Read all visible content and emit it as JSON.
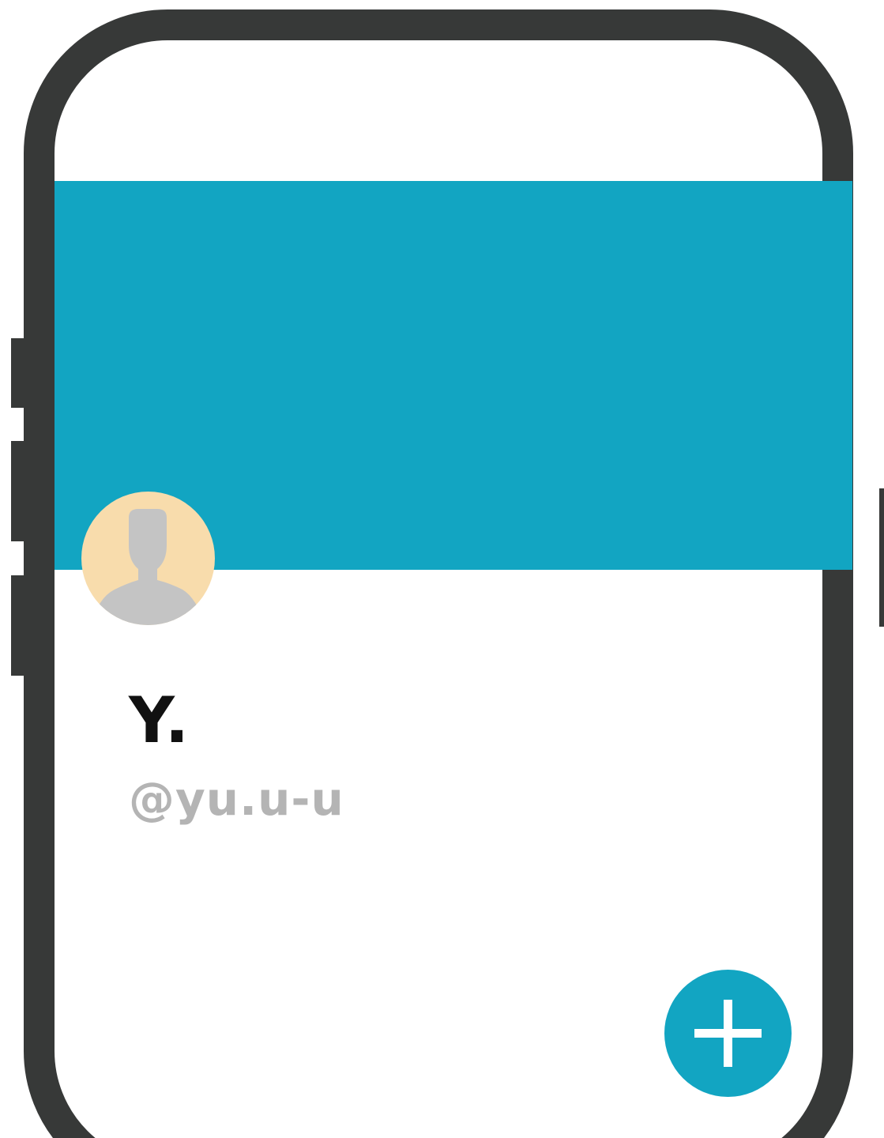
{
  "profile": {
    "display_name": "Y.",
    "handle": "@yu.u-u"
  },
  "icons": {
    "avatar": "person-silhouette-icon",
    "fab": "plus-icon"
  },
  "colors": {
    "frame": "#373938",
    "accent": "#12a5c2",
    "avatar_bg": "#f8dcac",
    "avatar_figure": "#c4c4c4",
    "handle_text": "#b4b4b4",
    "name_text": "#111111",
    "screen_bg": "#ffffff"
  }
}
